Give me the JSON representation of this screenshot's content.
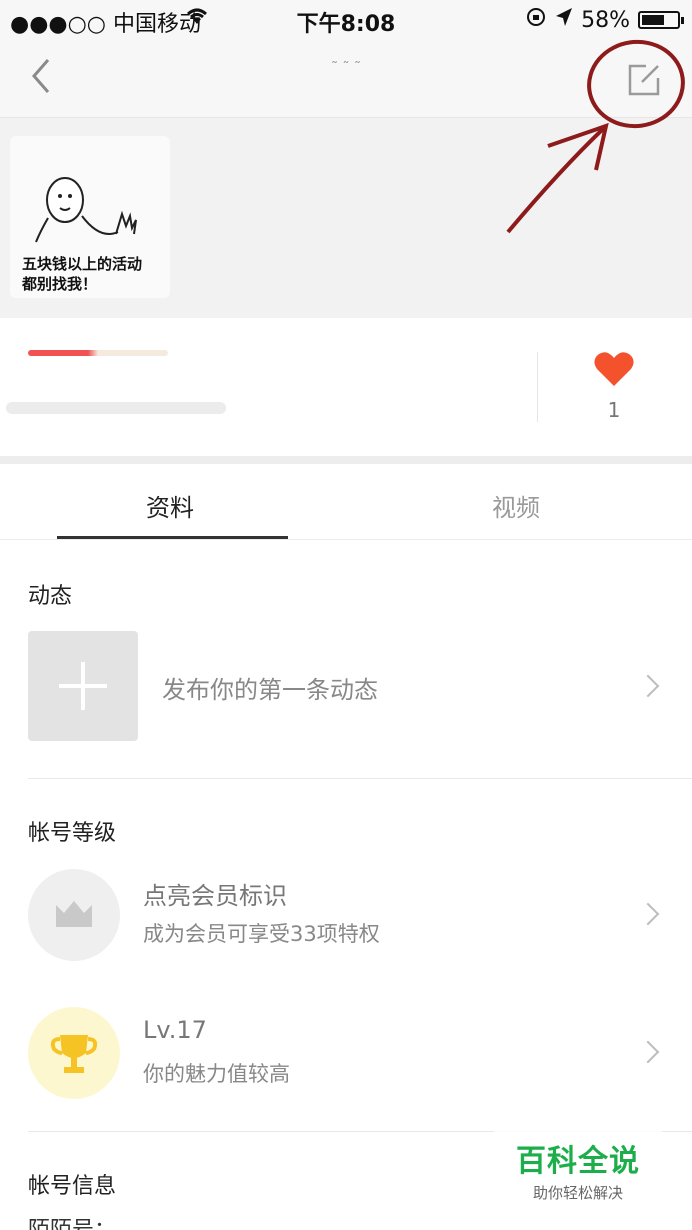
{
  "status_bar": {
    "carrier": "●●●○○ 中国移动",
    "time": "下午8:08",
    "battery": "58%"
  },
  "nav": {
    "title": "˜ ˜ ˜"
  },
  "cover": {
    "sticker_text_line1": "五块钱以上的活动",
    "sticker_text_line2": "都别找我！"
  },
  "profile": {
    "like_count": "1",
    "heart_color": "#f4522d"
  },
  "tabs": {
    "profile_label": "资料",
    "video_label": "视频"
  },
  "moments": {
    "title": "动态",
    "prompt": "发布你的第一条动态"
  },
  "level": {
    "title": "帐号等级",
    "member_title": "点亮会员标识",
    "member_sub": "成为会员可享受33项特权",
    "lv_title": "Lv.17",
    "lv_sub": "你的魅力值较高",
    "trophy_color": "#f6c324",
    "trophy_bg": "#fdf7cf"
  },
  "account": {
    "title": "帐号信息",
    "cut_label": "陌陌号："
  },
  "watermark": {
    "main": "百科全说",
    "sub": "助你轻松解决"
  }
}
